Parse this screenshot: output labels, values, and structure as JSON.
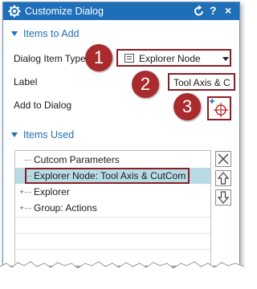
{
  "window": {
    "title": "Customize Dialog",
    "icons": [
      "gear-icon",
      "reset-icon",
      "help-icon",
      "close-icon"
    ],
    "help_glyph": "?",
    "close_glyph": "×"
  },
  "items_to_add": {
    "header": "Items to Add",
    "dialog_item_type_label": "Dialog Item Type",
    "dialog_item_type_value": "Explorer Node",
    "label_label": "Label",
    "label_value": "Tool Axis & C",
    "add_to_dialog_label": "Add to Dialog"
  },
  "items_used": {
    "header": "Items Used",
    "tree": [
      {
        "label": "Cutcom Parameters",
        "expandable": false,
        "selected": false
      },
      {
        "label": "Explorer Node: Tool Axis & CutCom",
        "expandable": false,
        "selected": true
      },
      {
        "label": "Explorer",
        "expandable": true,
        "selected": false
      },
      {
        "label": "Group: Actions",
        "expandable": true,
        "selected": false
      }
    ]
  },
  "callouts": [
    "1",
    "2",
    "3"
  ],
  "colors": {
    "title_bar": "#1f6fb8",
    "accent": "#1f6fb8",
    "callout": "#a92b2e",
    "highlight_border": "#8b1e24",
    "selection": "#b8dce5"
  }
}
